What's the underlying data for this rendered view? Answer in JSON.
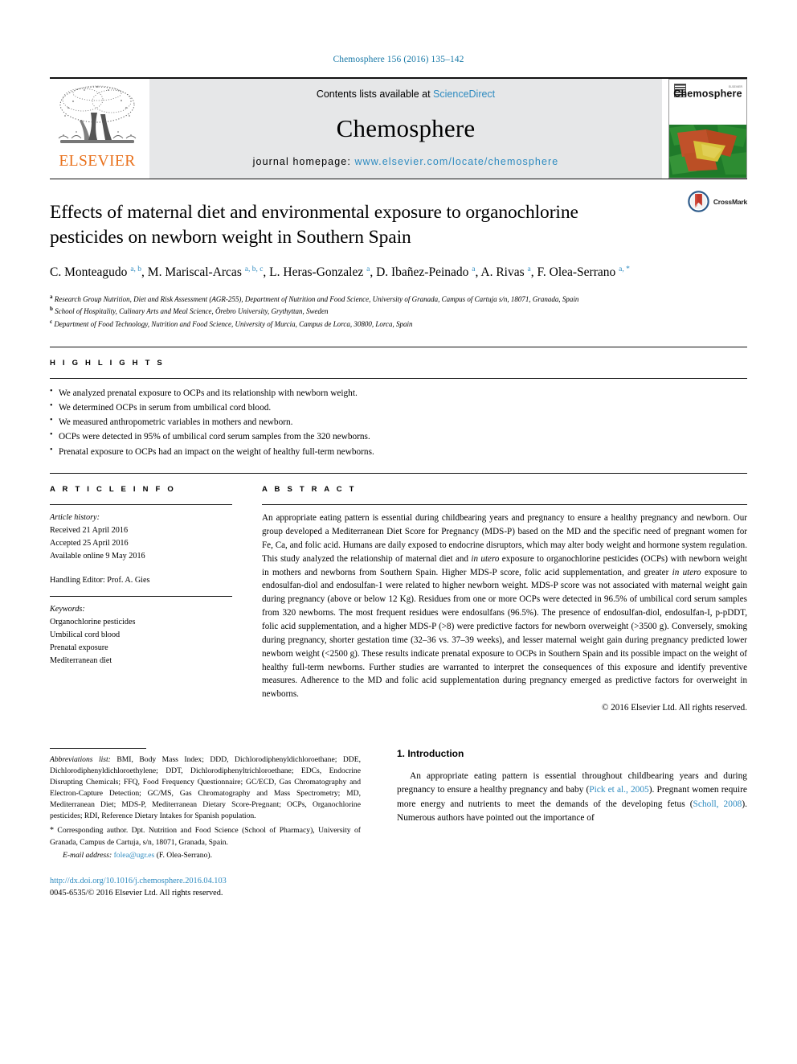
{
  "running_head": "Chemosphere 156 (2016) 135–142",
  "masthead": {
    "publisher_logo_text": "ELSEVIER",
    "contents_prefix": "Contents lists available at ",
    "contents_link": "ScienceDirect",
    "journal_name": "Chemosphere",
    "homepage_prefix": "journal homepage: ",
    "homepage_url": "www.elsevier.com/locate/chemosphere",
    "cover_title": "Chemosphere",
    "cover_publisher": "ELSEVIER"
  },
  "article": {
    "title": "Effects of maternal diet and environmental exposure to organochlorine pesticides on newborn weight in Southern Spain",
    "crossmark_label": "CrossMark",
    "authors_html": "C. Monteagudo <sup>a, b</sup>, M. Mariscal-Arcas <sup>a, b, c</sup>, L. Heras-Gonzalez <sup>a</sup>, D. Ibañez-Peinado <sup>a</sup>, A. Rivas <sup>a</sup>, F. Olea-Serrano <sup>a, *</sup>",
    "affiliations": [
      "Research Group Nutrition, Diet and Risk Assessment (AGR-255), Department of Nutrition and Food Science, University of Granada, Campus of Cartuja s/n, 18071, Granada, Spain",
      "School of Hospitality, Culinary Arts and Meal Science, Örebro University, Grythyttan, Sweden",
      "Department of Food Technology, Nutrition and Food Science, University of Murcia, Campus de Lorca, 30800, Lorca, Spain"
    ],
    "affiliation_marks": [
      "a",
      "b",
      "c"
    ]
  },
  "highlights": {
    "heading": "H I G H L I G H T S",
    "items": [
      "We analyzed prenatal exposure to OCPs and its relationship with newborn weight.",
      "We determined OCPs in serum from umbilical cord blood.",
      "We measured anthropometric variables in mothers and newborn.",
      "OCPs were detected in 95% of umbilical cord serum samples from the 320 newborns.",
      "Prenatal exposure to OCPs had an impact on the weight of healthy full-term newborns."
    ]
  },
  "article_info": {
    "heading": "A R T I C L E   I N F O",
    "history_label": "Article history:",
    "received": "Received 21 April 2016",
    "accepted": "Accepted 25 April 2016",
    "available": "Available online 9 May 2016",
    "handling_editor": "Handling Editor: Prof. A. Gies",
    "keywords_label": "Keywords:",
    "keywords": [
      "Organochlorine pesticides",
      "Umbilical cord blood",
      "Prenatal exposure",
      "Mediterranean diet"
    ]
  },
  "abstract": {
    "heading": "A B S T R A C T",
    "paragraph_html": "An appropriate eating pattern is essential during childbearing years and pregnancy to ensure a healthy pregnancy and newborn. Our group developed a Mediterranean Diet Score for Pregnancy (MDS-P) based on the MD and the specific need of pregnant women for Fe, Ca, and folic acid. Humans are daily exposed to endocrine disruptors, which may alter body weight and hormone system regulation. This study analyzed the relationship of maternal diet and <i>in utero</i> exposure to organochlorine pesticides (OCPs) with newborn weight in mothers and newborns from Southern Spain. Higher MDS-P score, folic acid supplementation, and greater <i>in utero</i> exposure to endosulfan-diol and endosulfan-1 were related to higher newborn weight. MDS-P score was not associated with maternal weight gain during pregnancy (above or below 12 Kg). Residues from one or more OCPs were detected in 96.5% of umbilical cord serum samples from 320 newborns. The most frequent residues were endosulfans (96.5%). The presence of endosulfan-diol, endosulfan-I, p-pDDT, folic acid supplementation, and a higher MDS-P (&gt;8) were predictive factors for newborn overweight (&gt;3500 g). Conversely, smoking during pregnancy, shorter gestation time (32–36 vs. 37–39 weeks), and lesser maternal weight gain during pregnancy predicted lower newborn weight (&lt;2500 g). These results indicate prenatal exposure to OCPs in Southern Spain and its possible impact on the weight of healthy full-term newborns. Further studies are warranted to interpret the consequences of this exposure and identify preventive measures. Adherence to the MD and folic acid supplementation during pregnancy emerged as predictive factors for overweight in newborns.",
    "copyright": "© 2016 Elsevier Ltd. All rights reserved."
  },
  "footer": {
    "abbreviations_label": "Abbreviations list:",
    "abbreviations_text": "BMI, Body Mass Index; DDD, Dichlorodiphenyldichloroethane; DDE, Dichlorodiphenyldichloroethylene; DDT, Dichlorodiphenyltrichloroethane; EDCs, Endocrine Disrupting Chemicals; FFQ, Food Frequency Questionnaire; GC/ECD, Gas Chromatography and Electron-Capture Detection; GC/MS, Gas Chromatography and Mass Spectrometry; MD, Mediterranean Diet; MDS-P, Mediterranean Dietary Score-Pregnant; OCPs, Organochlorine pesticides; RDI, Reference Dietary Intakes for Spanish population.",
    "corresponding_marker": "*",
    "corresponding_text": "Corresponding author. Dpt. Nutrition and Food Science (School of Pharmacy), University of Granada, Campus de Cartuja, s/n, 18071, Granada, Spain.",
    "email_label": "E-mail address:",
    "email": "folea@ugr.es",
    "email_owner": "(F. Olea-Serrano).",
    "doi": "http://dx.doi.org/10.1016/j.chemosphere.2016.04.103",
    "issn_line": "0045-6535/© 2016 Elsevier Ltd. All rights reserved."
  },
  "introduction": {
    "heading": "1. Introduction",
    "paragraph_html": "An appropriate eating pattern is essential throughout childbearing years and during pregnancy to ensure a healthy pregnancy and baby (<span class=\"link\">Pick et al., 2005</span>). Pregnant women require more energy and nutrients to meet the demands of the developing fetus (<span class=\"link\">Scholl, 2008</span>). Numerous authors have pointed out the importance of"
  },
  "colors": {
    "link": "#2e8bc0",
    "elsevier_orange": "#E9711C",
    "rule": "#111111",
    "band_gray": "#e6e7e8"
  }
}
